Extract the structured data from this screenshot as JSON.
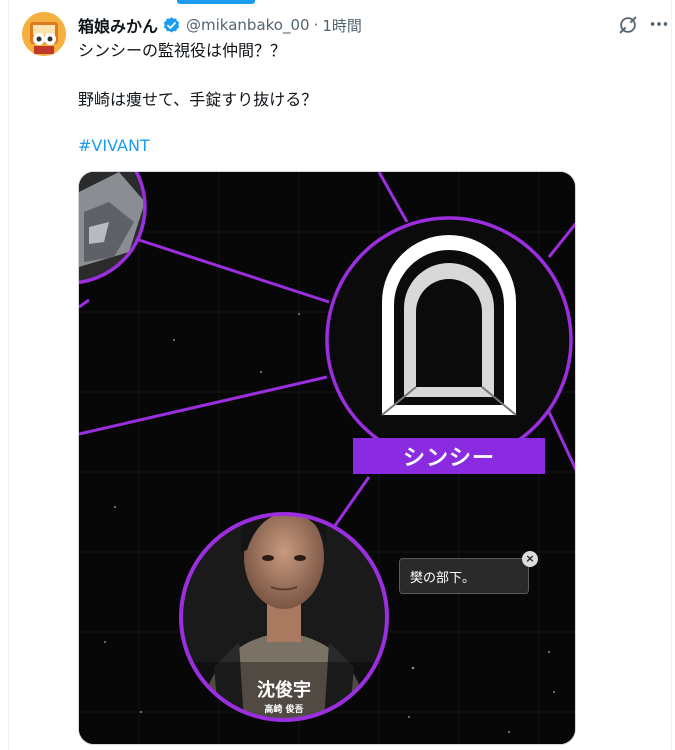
{
  "tweet": {
    "display_name": "箱娘みかん",
    "handle": "@mikanbako_00",
    "separator": "·",
    "time": "1時間",
    "text_line1": "シンシーの監視役は仲間？？",
    "text_line2": "野崎は痩せて、手錠すり抜ける？",
    "hashtag": "#VIVANT"
  },
  "media": {
    "node_label": "シンシー",
    "bubble_text": "樊の部下。",
    "bubble_close": "×",
    "person_name": "沈俊宇",
    "actor_name": "高崎 俊吾"
  },
  "icons": {
    "verified": "verified-badge-icon",
    "grok": "grok-icon",
    "more": "more-icon",
    "close": "close-icon"
  },
  "colors": {
    "accent": "#1d9bf0",
    "purple": "#8a2be2",
    "text": "#0f1419",
    "muted": "#536471"
  }
}
